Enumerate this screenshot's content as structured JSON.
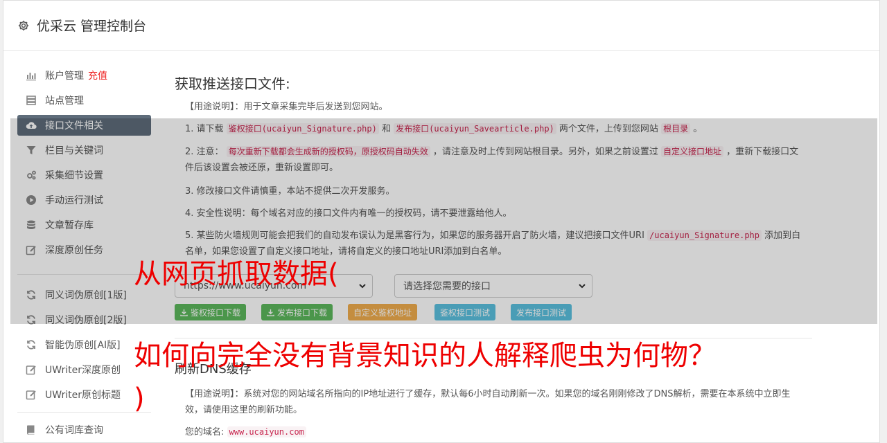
{
  "header": {
    "title": "优采云 管理控制台"
  },
  "sidebar": {
    "items": [
      {
        "label": "账户管理",
        "icon": "bar-chart-icon",
        "extra": "充值"
      },
      {
        "label": "站点管理",
        "icon": "server-icon"
      },
      {
        "label": "接口文件相关",
        "icon": "cloud-upload-icon",
        "active": true
      },
      {
        "label": "栏目与关键词",
        "icon": "filter-icon"
      },
      {
        "label": "采集细节设置",
        "icon": "gears-icon"
      },
      {
        "label": "手动运行测试",
        "icon": "play-circle-icon"
      },
      {
        "label": "文章暂存库",
        "icon": "database-icon"
      },
      {
        "label": "深度原创任务",
        "icon": "edit-icon"
      },
      {
        "label": "同义词伪原创[1版]",
        "icon": "refresh-icon"
      },
      {
        "label": "同义词伪原创[2版]",
        "icon": "refresh-icon"
      },
      {
        "label": "智能伪原创[AI版]",
        "icon": "refresh-icon"
      },
      {
        "label": "UWriter深度原创",
        "icon": "edit-icon"
      },
      {
        "label": "UWriter原创标题",
        "icon": "edit-icon"
      },
      {
        "label": "公有词库查询",
        "icon": "book-icon"
      }
    ]
  },
  "section1": {
    "title": "获取推送接口文件:",
    "usage_label": "【用途说明】",
    "usage_text": "：用于文章采集完毕后发送到您网站。",
    "item1": {
      "a": "1. 请下载",
      "code1": "鉴权接口(ucaiyun_Signature.php)",
      "b": "和",
      "code2": "发布接口(ucaiyun_Savearticle.php)",
      "c": "两个文件，上传到您网站",
      "code3": "根目录",
      "d": "。"
    },
    "item2": {
      "a": "2. 注意：",
      "code1": "每次重新下载都会生成新的授权码，原授权码自动失效",
      "b": "，请注意及时上传到网站根目录。另外，如果之前设置过",
      "code2": "自定义接口地址",
      "c": "，重新下载接口文件后该设置会被还原，重新设置即可。"
    },
    "item3": "3. 修改接口文件请慎重，本站不提供二次开发服务。",
    "item4": "4. 安全性说明：每个域名对应的接口文件内有唯一的授权码，请不要泄露给他人。",
    "item5": {
      "a": "5. 某些防火墙规则可能会把我们的自动发布误认为是黑客行为，如果您的服务器开启了防火墙，建议把接口文件URI",
      "code1": "/ucaiyun_Signature.php",
      "b": "添加到白名单，如果您设置了自定义接口地址，请将自定义的接口地址URI添加到白名单。"
    },
    "site_select": "https://www.ucaiyun.com",
    "interface_select": "请选择您需要的接口",
    "buttons": {
      "auth_download": "鉴权接口下载",
      "publish_download": "发布接口下载",
      "custom_auth": "自定义鉴权地址",
      "auth_test": "鉴权接口测试",
      "publish_test": "发布接口测试"
    }
  },
  "section2": {
    "title": "刷新DNS缓存",
    "usage_label": "【用途说明】",
    "usage_text": "：系统对您的网站域名所指向的IP地址进行了缓存，默认每6小时自动刷新一次。如果您的域名刚刚修改了DNS解析，需要在本系统中立即生效，请使用这里的刷新功能。",
    "domain_label": "您的域名:",
    "domain_value": "www.ucaiyun.com"
  },
  "watermark": {
    "line1": "从网页抓取数据(",
    "line2": "如何向完全没有背景知识的人解释爬虫为何物？",
    "line3": ")"
  },
  "colors": {
    "active_nav": "#5e6c7a",
    "recharge": "#ee2222",
    "btn_green": "#5cb85c",
    "btn_orange": "#f0ad4e",
    "btn_blue": "#5bc0de",
    "watermark": "#ee0000"
  }
}
